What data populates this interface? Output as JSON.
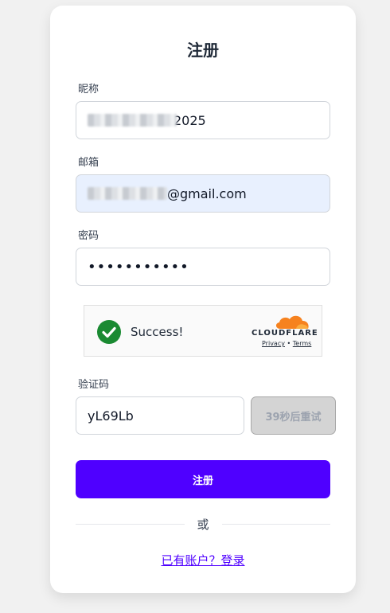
{
  "form": {
    "title": "注册",
    "nickname": {
      "label": "昵称",
      "value_visible_suffix": "2025"
    },
    "email": {
      "label": "邮箱",
      "value_visible_suffix": "@gmail.com"
    },
    "password": {
      "label": "密码",
      "value_masked": "•••••••••••"
    },
    "captcha_widget": {
      "status": "Success!",
      "brand": "CLOUDFLARE",
      "privacy_link": "Privacy",
      "separator": "•",
      "terms_link": "Terms"
    },
    "verification": {
      "label": "验证码",
      "value": "yL69Lb",
      "retry_label": "39秒后重试"
    },
    "submit_label": "注册",
    "divider_text": "或",
    "login_link": "已有账户？登录"
  },
  "colors": {
    "accent": "#4f00ff",
    "success_check": "#1a8a32",
    "cloudflare_orange": "#f6821f"
  }
}
